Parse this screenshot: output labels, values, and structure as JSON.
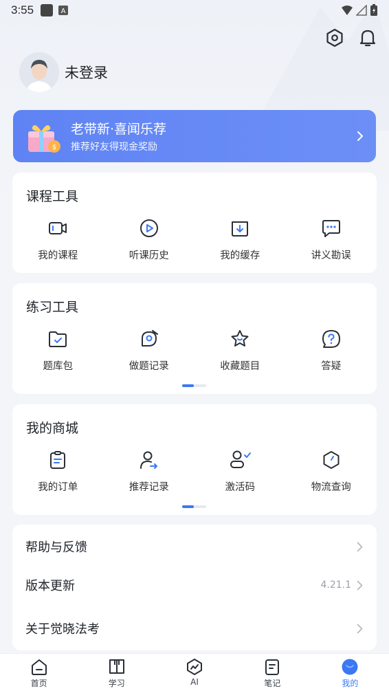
{
  "status_bar": {
    "time": "3:55"
  },
  "profile": {
    "name": "未登录"
  },
  "banner": {
    "title": "老带新·喜闻乐荐",
    "subtitle": "推荐好友得现金奖励"
  },
  "course_tools": {
    "title": "课程工具",
    "items": [
      {
        "label": "我的课程",
        "icon": "video-icon"
      },
      {
        "label": "听课历史",
        "icon": "play-circle-icon"
      },
      {
        "label": "我的缓存",
        "icon": "download-box-icon"
      },
      {
        "label": "讲义勘误",
        "icon": "chat-dots-icon"
      }
    ]
  },
  "practice_tools": {
    "title": "练习工具",
    "items": [
      {
        "label": "题库包",
        "icon": "folder-icon"
      },
      {
        "label": "做题记录",
        "icon": "pen-record-icon"
      },
      {
        "label": "收藏题目",
        "icon": "star-icon"
      },
      {
        "label": "答疑",
        "icon": "question-icon"
      }
    ]
  },
  "mall": {
    "title": "我的商城",
    "items": [
      {
        "label": "我的订单",
        "icon": "clipboard-icon"
      },
      {
        "label": "推荐记录",
        "icon": "user-arrow-icon"
      },
      {
        "label": "激活码",
        "icon": "user-check-icon"
      },
      {
        "label": "物流查询",
        "icon": "hexagon-clock-icon"
      }
    ]
  },
  "list": [
    {
      "label": "帮助与反馈",
      "value": ""
    },
    {
      "label": "版本更新",
      "value": "4.21.1"
    },
    {
      "label": "关于觉晓法考",
      "value": ""
    }
  ],
  "tabbar": {
    "tabs": [
      {
        "label": "首页",
        "icon": "home-icon"
      },
      {
        "label": "学习",
        "icon": "book-icon"
      },
      {
        "label": "AI",
        "icon": "ai-icon"
      },
      {
        "label": "笔记",
        "icon": "note-icon"
      },
      {
        "label": "我的",
        "icon": "profile-tab-icon"
      }
    ],
    "active_index": 4
  },
  "colors": {
    "accent": "#3b78f2",
    "banner": "#6389f5"
  }
}
